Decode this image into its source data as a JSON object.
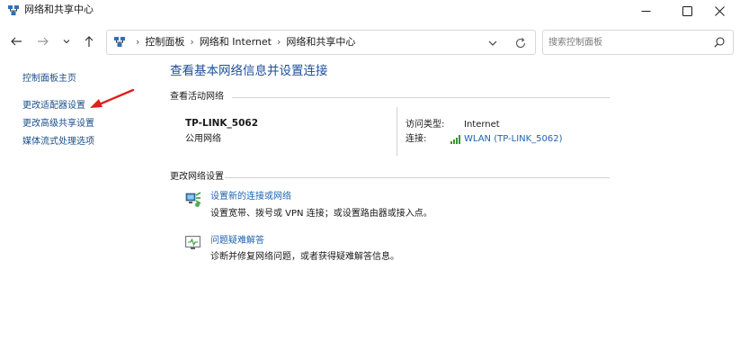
{
  "window": {
    "title": "网络和共享中心"
  },
  "address": {
    "breadcrumbs": [
      "控制面板",
      "网络和 Internet",
      "网络和共享中心"
    ],
    "search_placeholder": "搜索控制面板"
  },
  "sidebar": {
    "items": [
      {
        "label": "控制面板主页"
      },
      {
        "label": "更改适配器设置"
      },
      {
        "label": "更改高级共享设置"
      },
      {
        "label": "媒体流式处理选项"
      }
    ]
  },
  "main": {
    "title": "查看基本网络信息并设置连接",
    "active_networks": {
      "heading": "查看活动网络",
      "network_name": "TP-LINK_5062",
      "network_type": "公用网络",
      "access_type_label": "访问类型:",
      "access_type_value": "Internet",
      "connection_label": "连接:",
      "connection_value": "WLAN (TP-LINK_5062)"
    },
    "change_settings": {
      "heading": "更改网络设置",
      "tasks": [
        {
          "link": "设置新的连接或网络",
          "description": "设置宽带、拨号或 VPN 连接；或设置路由器或接入点。",
          "icon": "network-setup-icon"
        },
        {
          "link": "问题疑难解答",
          "description": "诊断并修复网络问题，或者获得疑难解答信息。",
          "icon": "troubleshoot-icon"
        }
      ]
    }
  },
  "colors": {
    "link": "#1e63b0",
    "title": "#1e4f9a",
    "arrow": "#e0201b"
  }
}
